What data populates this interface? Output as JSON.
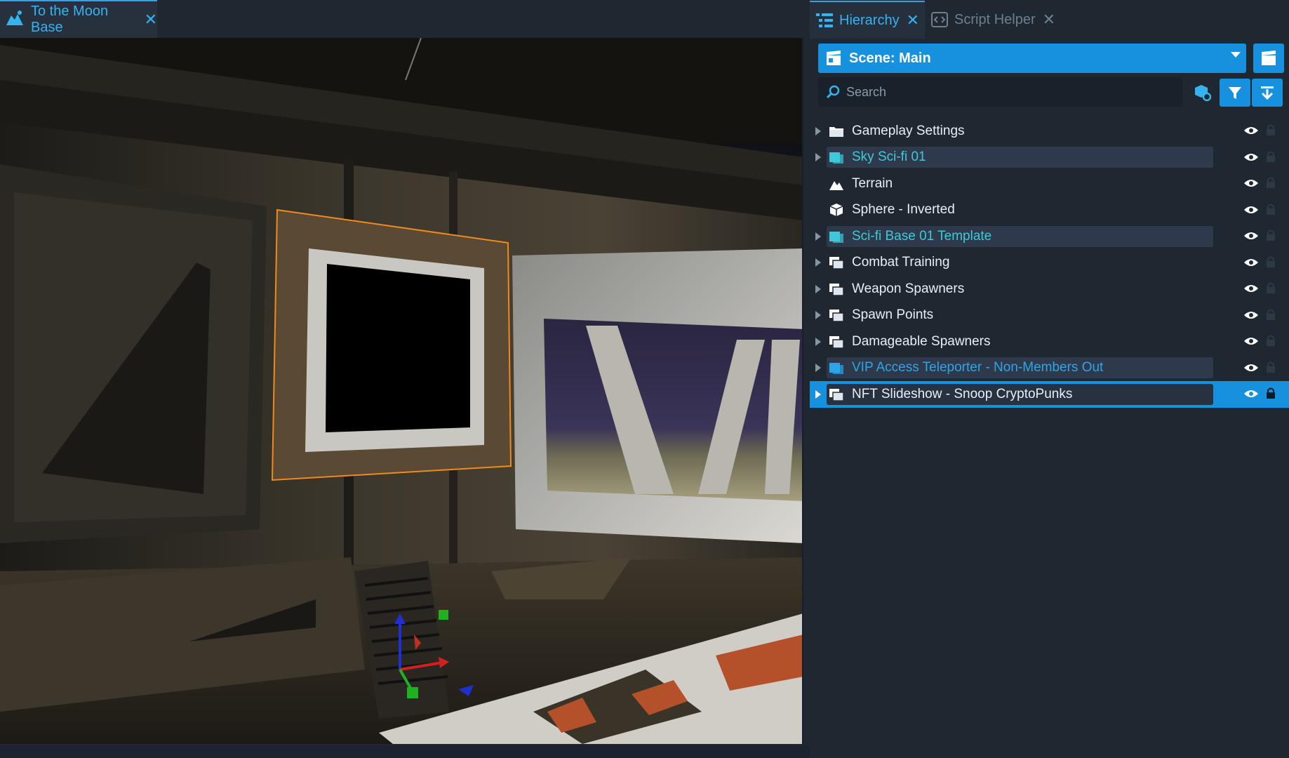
{
  "viewport": {
    "tab_label": "To the Moon Base",
    "tab_close": "✕"
  },
  "panel": {
    "tabs": [
      {
        "label": "Hierarchy",
        "close": "✕",
        "active": true
      },
      {
        "label": "Script Helper",
        "close": "✕",
        "active": false
      }
    ],
    "scene_selector": {
      "label": "Scene: Main"
    },
    "search": {
      "placeholder": "Search"
    },
    "items": [
      {
        "label": "Gameplay Settings",
        "icon": "folder-icon",
        "expandable": true,
        "style": "normal"
      },
      {
        "label": "Sky Sci-fi 01",
        "icon": "template-icon",
        "expandable": true,
        "style": "template"
      },
      {
        "label": "Terrain",
        "icon": "terrain-icon",
        "expandable": false,
        "style": "normal"
      },
      {
        "label": "Sphere - Inverted",
        "icon": "cube-icon",
        "expandable": false,
        "style": "normal"
      },
      {
        "label": "Sci-fi Base 01 Template",
        "icon": "template-icon",
        "expandable": true,
        "style": "template"
      },
      {
        "label": "Combat Training",
        "icon": "group-icon",
        "expandable": true,
        "style": "normal"
      },
      {
        "label": "Weapon Spawners",
        "icon": "group-icon",
        "expandable": true,
        "style": "normal"
      },
      {
        "label": "Spawn Points",
        "icon": "group-icon",
        "expandable": true,
        "style": "normal"
      },
      {
        "label": "Damageable Spawners",
        "icon": "group-icon",
        "expandable": true,
        "style": "normal"
      },
      {
        "label": "VIP Access Teleporter - Non-Members Out",
        "icon": "template-icon",
        "expandable": true,
        "style": "template-blue"
      },
      {
        "label": "NFT Slideshow - Snoop CryptoPunks",
        "icon": "group-icon",
        "expandable": true,
        "style": "selected"
      }
    ]
  },
  "colors": {
    "accent": "#1691de",
    "template_cyan": "#3fc9d8",
    "template_blue": "#2aa7e8",
    "panel_bg": "#1f2731",
    "selection_outline": "#f08a1c"
  }
}
